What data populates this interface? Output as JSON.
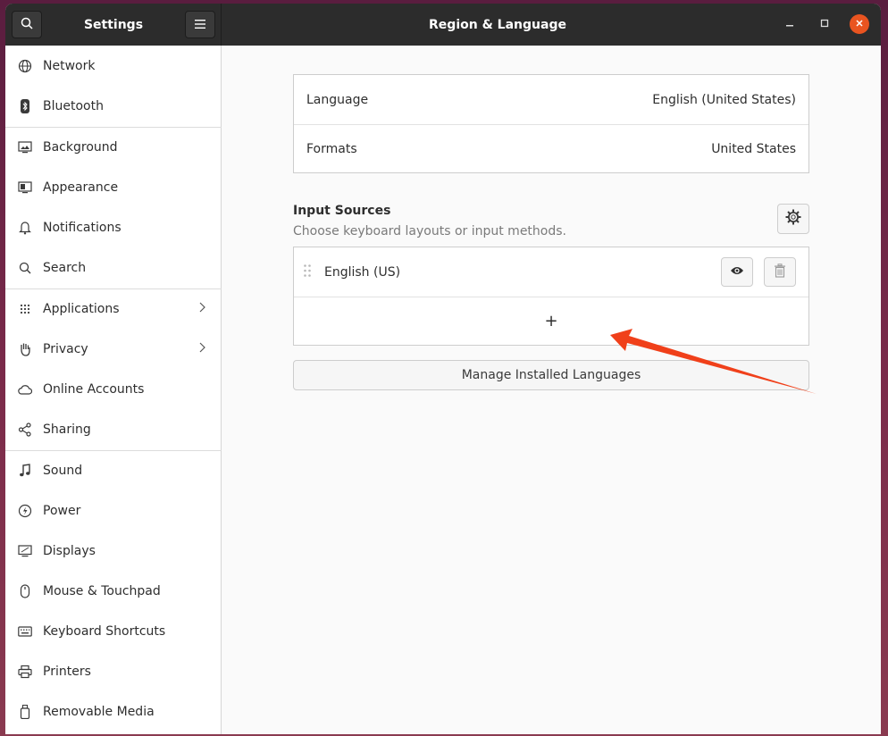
{
  "header": {
    "sidebar_title": "Settings",
    "page_title": "Region & Language",
    "search_icon": "search-icon",
    "menu_icon": "hamburger-menu-icon"
  },
  "sidebar": {
    "items": [
      {
        "label": "Network",
        "icon": "globe-icon"
      },
      {
        "label": "Bluetooth",
        "icon": "bluetooth-icon"
      },
      {
        "label": "Background",
        "icon": "background-icon"
      },
      {
        "label": "Appearance",
        "icon": "appearance-icon"
      },
      {
        "label": "Notifications",
        "icon": "bell-icon"
      },
      {
        "label": "Search",
        "icon": "search-icon"
      },
      {
        "label": "Applications",
        "icon": "grid-icon"
      },
      {
        "label": "Privacy",
        "icon": "hand-icon"
      },
      {
        "label": "Online Accounts",
        "icon": "cloud-icon"
      },
      {
        "label": "Sharing",
        "icon": "share-icon"
      },
      {
        "label": "Sound",
        "icon": "music-note-icon"
      },
      {
        "label": "Power",
        "icon": "power-icon"
      },
      {
        "label": "Displays",
        "icon": "display-icon"
      },
      {
        "label": "Mouse & Touchpad",
        "icon": "mouse-icon"
      },
      {
        "label": "Keyboard Shortcuts",
        "icon": "keyboard-icon"
      },
      {
        "label": "Printers",
        "icon": "printer-icon"
      },
      {
        "label": "Removable Media",
        "icon": "usb-drive-icon"
      }
    ]
  },
  "region": {
    "language_label": "Language",
    "language_value": "English (United States)",
    "formats_label": "Formats",
    "formats_value": "United States"
  },
  "input_sources": {
    "title": "Input Sources",
    "subtitle": "Choose keyboard layouts or input methods.",
    "sources": [
      {
        "label": "English (US)"
      }
    ],
    "add_symbol": "+",
    "manage_button": "Manage Installed Languages"
  },
  "colors": {
    "headerbar": "#2c2c2c",
    "close_button": "#e95420",
    "annotation_arrow": "#f0401a"
  }
}
